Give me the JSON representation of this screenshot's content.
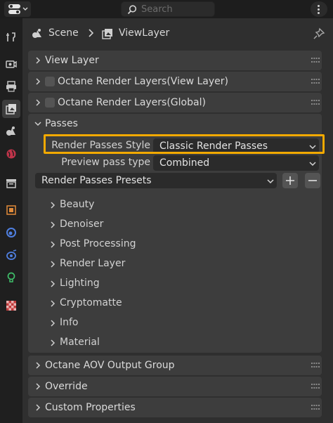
{
  "header": {
    "search_placeholder": "Search"
  },
  "breadcrumb": {
    "scene": "Scene",
    "view_layer": "ViewLayer"
  },
  "panels": {
    "view_layer": "View Layer",
    "octane_layers_view": "Octane Render Layers(View Layer)",
    "octane_layers_global": "Octane Render Layers(Global)",
    "passes": "Passes",
    "octane_aov": "Octane AOV Output Group",
    "override": "Override",
    "custom_properties": "Custom Properties"
  },
  "passes": {
    "style_label": "Render Passes Style",
    "style_value": "Classic Render Passes",
    "preview_label": "Preview pass type",
    "preview_value": "Combined",
    "presets_value": "Render Passes Presets",
    "subpanels": [
      "Beauty",
      "Denoiser",
      "Post Processing",
      "Render Layer",
      "Lighting",
      "Cryptomatte",
      "Info",
      "Material"
    ]
  },
  "colors": {
    "highlight": "#f2a900",
    "panel": "#3d3d3d",
    "field": "#2b2b2b"
  },
  "icons": [
    "editor-type-icon",
    "search-icon",
    "menu-dots-icon",
    "tool-icon",
    "render-icon",
    "output-icon",
    "view-layer-icon",
    "scene-icon",
    "world-icon",
    "collection-icon",
    "object-icon",
    "modifier-icon",
    "particles-icon",
    "physics-icon",
    "texture-icon",
    "pin-icon"
  ]
}
